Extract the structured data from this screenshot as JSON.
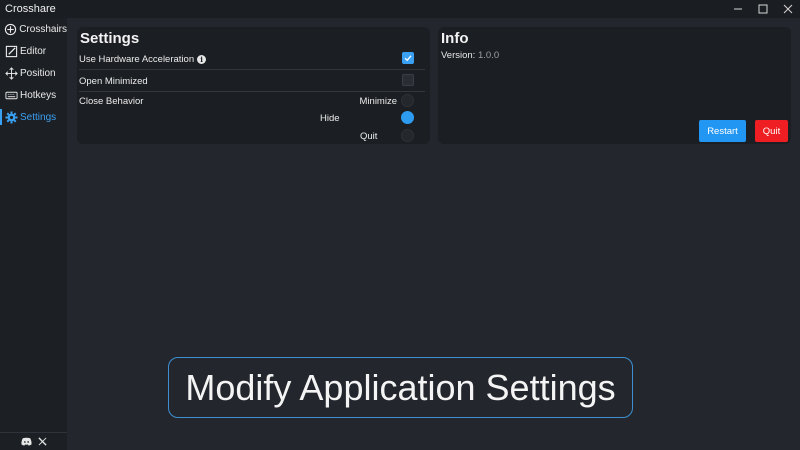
{
  "window": {
    "title": "Crosshare",
    "controls": {
      "minimize_icon": "minimize-icon",
      "maximize_icon": "maximize-icon",
      "close_icon": "close-icon"
    }
  },
  "sidebar": {
    "items": [
      {
        "label": "Crosshairs",
        "icon": "crosshair-icon"
      },
      {
        "label": "Editor",
        "icon": "edit-icon"
      },
      {
        "label": "Position",
        "icon": "move-icon"
      },
      {
        "label": "Hotkeys",
        "icon": "keyboard-icon"
      },
      {
        "label": "Settings",
        "icon": "gear-icon",
        "active": true
      }
    ],
    "footer_icons": [
      "discord-icon",
      "x-icon"
    ]
  },
  "settings": {
    "title": "Settings",
    "hardware_acceleration": {
      "label": "Use Hardware Acceleration",
      "checked": true
    },
    "open_minimized": {
      "label": "Open Minimized",
      "checked": false
    },
    "close_behavior": {
      "label": "Close Behavior",
      "options": [
        "Minimize",
        "Hide",
        "Quit"
      ],
      "selected": "Hide"
    }
  },
  "info": {
    "title": "Info",
    "version_label": "Version:",
    "version_value": "1.0.0",
    "restart_label": "Restart",
    "quit_label": "Quit"
  },
  "caption": "Modify Application Settings",
  "colors": {
    "accent": "#2196f3",
    "danger": "#ef1e22",
    "background": "#23272d",
    "panel": "#1b1e22"
  }
}
